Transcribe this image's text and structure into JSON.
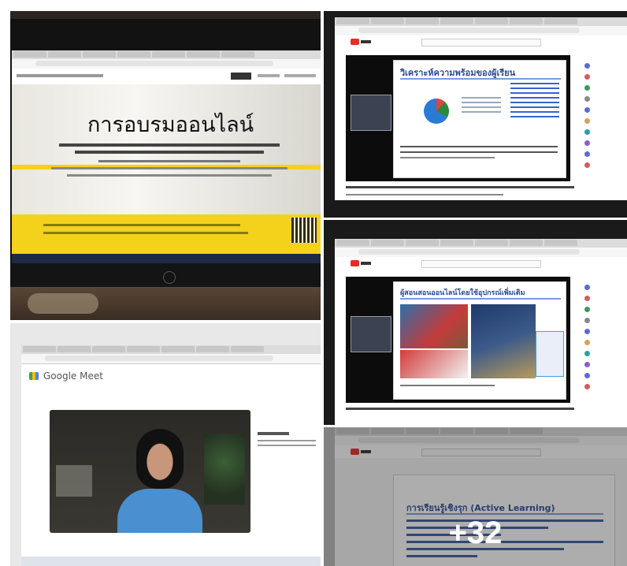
{
  "photo1": {
    "slide_title": "การอบรมออนไลน์"
  },
  "photo2": {
    "slide_title": "วิเคราะห์ความพร้อมของผู้เรียน"
  },
  "photo3": {
    "slide_title": "ผู้สอนสอนออนไลน์โดยใช้อุปกรณ์เพิ่มเติม"
  },
  "photo4": {
    "app_name": "Google Meet"
  },
  "photo5": {
    "slide_title": "การเรียนรู้เชิงรุก (Active Learning)"
  },
  "more_overlay": {
    "label": "+32"
  },
  "colors": {
    "youtube_red": "#e52d27",
    "slide_title_blue": "#2a4a9a",
    "banner_yellow": "#f4d21c",
    "overlay_text": "#ffffff"
  }
}
